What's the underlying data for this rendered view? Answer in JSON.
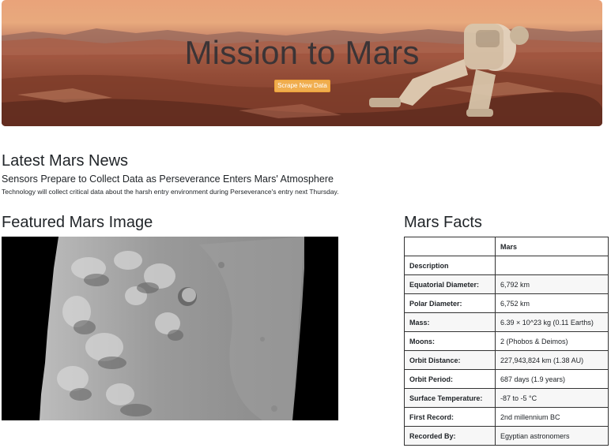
{
  "hero": {
    "title": "Mission to Mars",
    "button_label": "Scrape New Data"
  },
  "news": {
    "heading": "Latest Mars News",
    "title": "Sensors Prepare to Collect Data as Perseverance Enters Mars' Atmosphere",
    "paragraph": "Technology will collect critical data about the harsh entry environment during Perseverance's entry next Thursday."
  },
  "featured": {
    "heading": "Featured Mars Image"
  },
  "facts": {
    "heading": "Mars Facts",
    "header": [
      "",
      "Mars"
    ],
    "rows": [
      {
        "label": "Description",
        "value": ""
      },
      {
        "label": "Equatorial Diameter:",
        "value": "6,792 km"
      },
      {
        "label": "Polar Diameter:",
        "value": "6,752 km"
      },
      {
        "label": "Mass:",
        "value": "6.39 × 10^23 kg (0.11 Earths)"
      },
      {
        "label": "Moons:",
        "value": "2 (Phobos & Deimos)"
      },
      {
        "label": "Orbit Distance:",
        "value": "227,943,824 km (1.38 AU)"
      },
      {
        "label": "Orbit Period:",
        "value": "687 days (1.9 years)"
      },
      {
        "label": "Surface Temperature:",
        "value": "-87 to -5 °C"
      },
      {
        "label": "First Record:",
        "value": "2nd millennium BC"
      },
      {
        "label": "Recorded By:",
        "value": "Egyptian astronomers"
      }
    ]
  },
  "colors": {
    "button": "#f0ad4e",
    "hero_sky": "#e9a37a",
    "hero_ground": "#6f3628"
  }
}
